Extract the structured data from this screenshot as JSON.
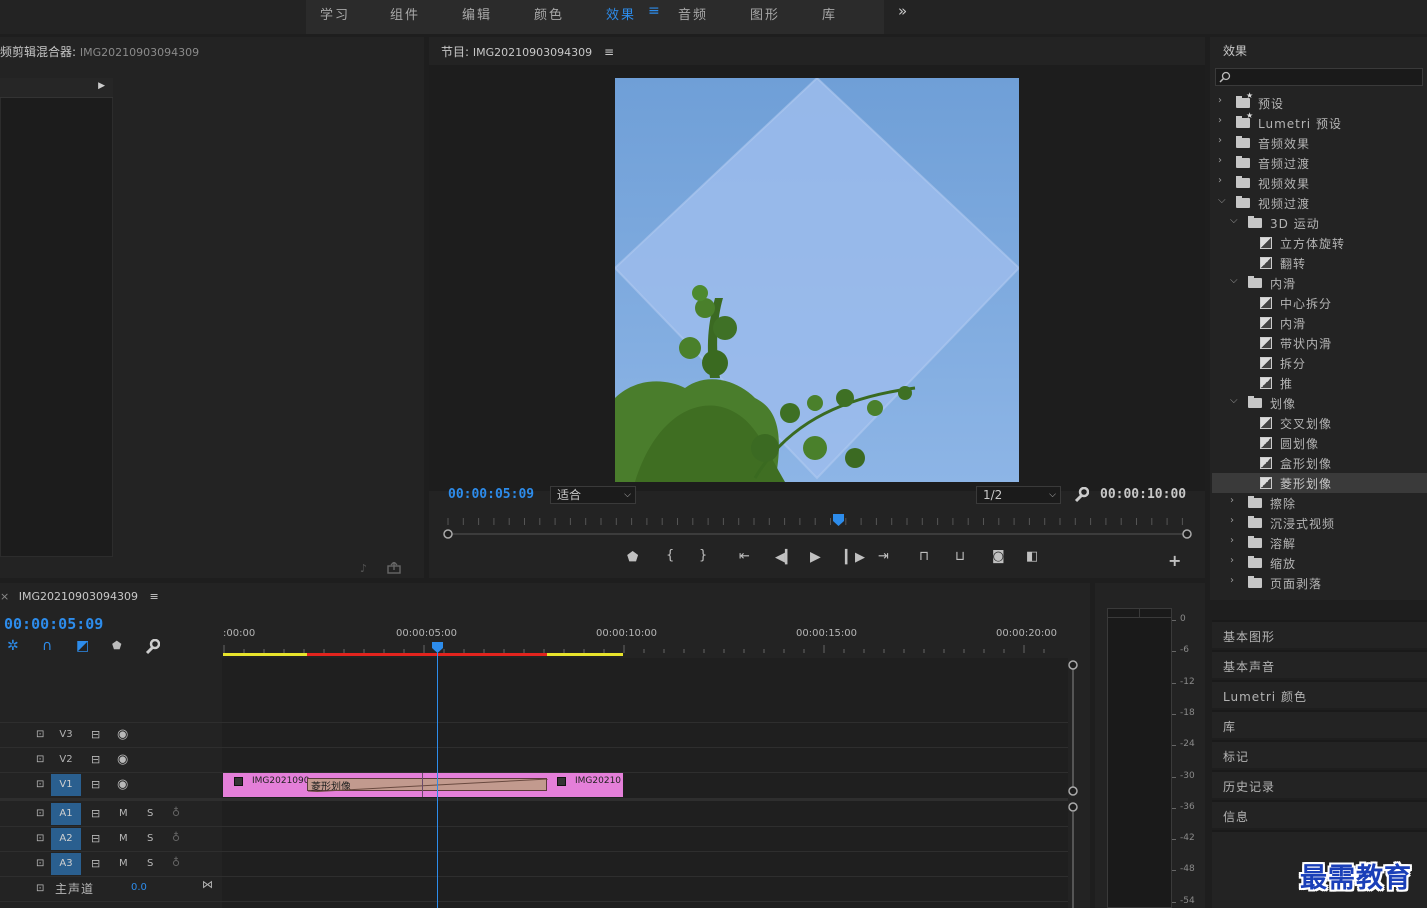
{
  "workspaces": [
    {
      "label": "学习",
      "active": false
    },
    {
      "label": "组件",
      "active": false
    },
    {
      "label": "编辑",
      "active": false
    },
    {
      "label": "颜色",
      "active": false
    },
    {
      "label": "效果",
      "active": true
    },
    {
      "label": "音频",
      "active": false
    },
    {
      "label": "图形",
      "active": false
    },
    {
      "label": "库",
      "active": false
    }
  ],
  "menu_glyph": "≡",
  "more_glyph": "»",
  "audio_mixer": {
    "title": "频剪辑混合器:",
    "clip": "IMG20210903094309"
  },
  "program": {
    "title": "节目:",
    "clip": "IMG20210903094309",
    "timecode": "00:00:05:09",
    "zoom": "适合",
    "resolution": "1/2",
    "duration": "00:00:10:00",
    "playhead_fraction": 0.53
  },
  "effects": {
    "title": "效果",
    "search_placeholder": "",
    "items": [
      {
        "label": "预设",
        "level": 0,
        "kind": "star-folder",
        "expanded": false
      },
      {
        "label": "Lumetri 预设",
        "level": 0,
        "kind": "star-folder",
        "expanded": false
      },
      {
        "label": "音频效果",
        "level": 0,
        "kind": "folder",
        "expanded": false
      },
      {
        "label": "音频过渡",
        "level": 0,
        "kind": "folder",
        "expanded": false
      },
      {
        "label": "视频效果",
        "level": 0,
        "kind": "folder",
        "expanded": false
      },
      {
        "label": "视频过渡",
        "level": 0,
        "kind": "folder",
        "expanded": true
      },
      {
        "label": "3D 运动",
        "level": 1,
        "kind": "folder",
        "expanded": true
      },
      {
        "label": "立方体旋转",
        "level": 2,
        "kind": "fx"
      },
      {
        "label": "翻转",
        "level": 2,
        "kind": "fx"
      },
      {
        "label": "内滑",
        "level": 1,
        "kind": "folder",
        "expanded": true
      },
      {
        "label": "中心拆分",
        "level": 2,
        "kind": "fx"
      },
      {
        "label": "内滑",
        "level": 2,
        "kind": "fx"
      },
      {
        "label": "带状内滑",
        "level": 2,
        "kind": "fx"
      },
      {
        "label": "拆分",
        "level": 2,
        "kind": "fx"
      },
      {
        "label": "推",
        "level": 2,
        "kind": "fx"
      },
      {
        "label": "划像",
        "level": 1,
        "kind": "folder",
        "expanded": true
      },
      {
        "label": "交叉划像",
        "level": 2,
        "kind": "fx"
      },
      {
        "label": "圆划像",
        "level": 2,
        "kind": "fx"
      },
      {
        "label": "盒形划像",
        "level": 2,
        "kind": "fx"
      },
      {
        "label": "菱形划像",
        "level": 2,
        "kind": "fx",
        "selected": true
      },
      {
        "label": "擦除",
        "level": 1,
        "kind": "folder",
        "expanded": false
      },
      {
        "label": "沉浸式视频",
        "level": 1,
        "kind": "folder",
        "expanded": false
      },
      {
        "label": "溶解",
        "level": 1,
        "kind": "folder",
        "expanded": false
      },
      {
        "label": "缩放",
        "level": 1,
        "kind": "folder",
        "expanded": false
      },
      {
        "label": "页面剥落",
        "level": 1,
        "kind": "folder",
        "expanded": false
      }
    ],
    "panels": [
      "基本图形",
      "基本声音",
      "Lumetri 颜色",
      "库",
      "标记",
      "历史记录",
      "信息"
    ]
  },
  "timeline": {
    "sequence": "IMG20210903094309",
    "timecode": "00:00:05:09",
    "ruler": [
      ":00:00",
      "00:00:05:00",
      "00:00:10:00",
      "00:00:15:00",
      "00:00:20:00"
    ],
    "video_tracks": [
      "V3",
      "V2",
      "V1"
    ],
    "audio_tracks": [
      "A1",
      "A2",
      "A3"
    ],
    "mute": "M",
    "solo": "S",
    "master": {
      "label": "主声道",
      "value": "0.0"
    },
    "clip_a": "IMG2021090",
    "transition": "菱形划像",
    "clip_b": "IMG20210",
    "colors": {
      "clip": "#e47fd9",
      "transition": "#c29a8e",
      "playhead": "#2d8ceb",
      "render_red": "#e2241e",
      "render_yellow": "#e8e42c"
    }
  },
  "meter": {
    "labels": [
      "0",
      "-6",
      "-12",
      "-18",
      "-24",
      "-30",
      "-36",
      "-42",
      "-48",
      "-54"
    ]
  },
  "watermark": "最需教育"
}
